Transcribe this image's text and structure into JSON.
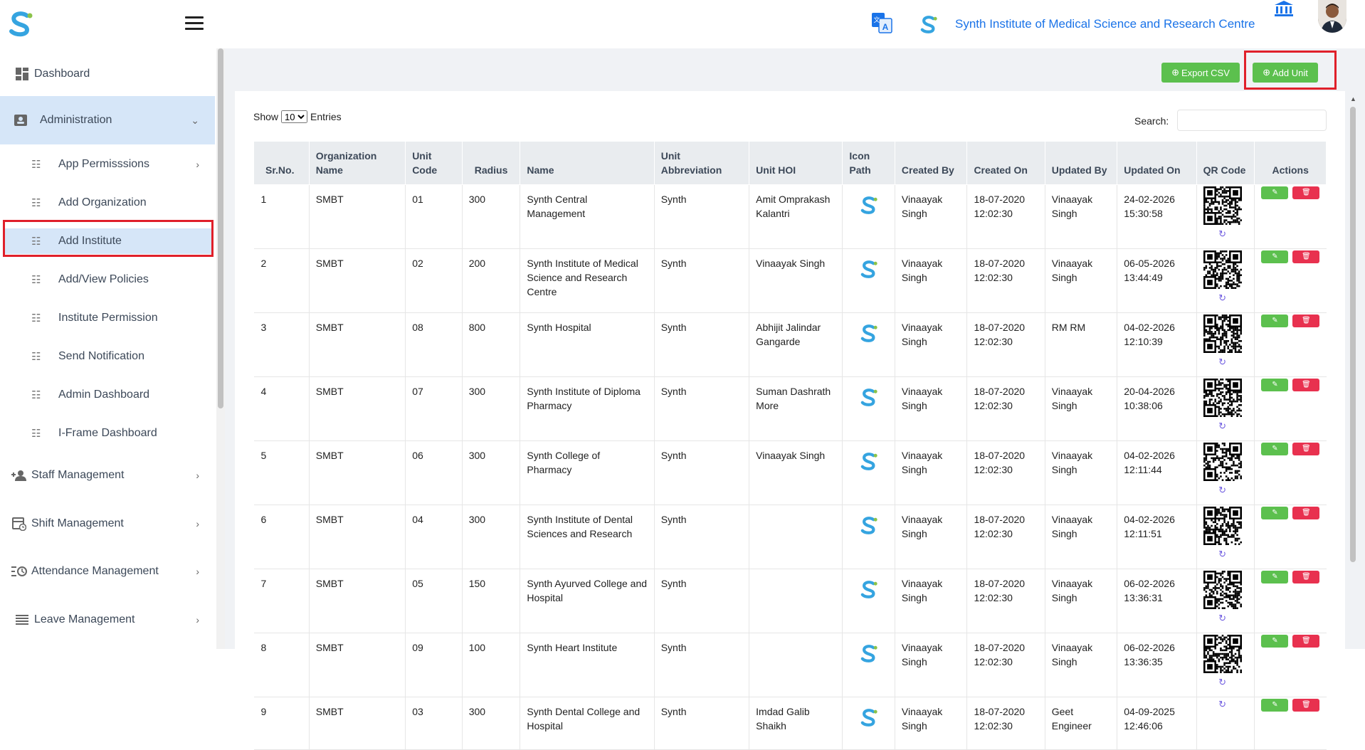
{
  "header": {
    "institute_name": "Synth Institute of Medical Science and Research Centre",
    "icons": [
      "logo-icon",
      "menu-icon",
      "translate-icon",
      "bank-icon"
    ]
  },
  "sidebar": {
    "dashboard": "Dashboard",
    "administration": "Administration",
    "sub_items": [
      {
        "label": "App Permisssions",
        "has_chevron": true
      },
      {
        "label": "Add Organization",
        "has_chevron": false
      },
      {
        "label": "Add Institute",
        "has_chevron": false
      },
      {
        "label": "Add/View Policies",
        "has_chevron": false
      },
      {
        "label": "Institute Permission",
        "has_chevron": false
      },
      {
        "label": "Send Notification",
        "has_chevron": false
      },
      {
        "label": "Admin Dashboard",
        "has_chevron": false
      },
      {
        "label": "I-Frame Dashboard",
        "has_chevron": false
      }
    ],
    "staff": "Staff Management",
    "shift": "Shift Management",
    "attendance": "Attendance Management",
    "leave": "Leave Management"
  },
  "toolbar": {
    "export_label": "Export CSV",
    "add_unit_label": "Add Unit"
  },
  "controls": {
    "show": "Show",
    "entries_value": "10",
    "entries": "Entries",
    "search": "Search:"
  },
  "table": {
    "headers": [
      "Sr.No.",
      "Organization Name",
      "Unit Code",
      "Radius",
      "Name",
      "Unit Abbreviation",
      "Unit HOI",
      "Icon Path",
      "Created By",
      "Created On",
      "Updated By",
      "Updated On",
      "QR Code",
      "Actions"
    ],
    "rows": [
      {
        "sr": "1",
        "org": "SMBT",
        "code": "01",
        "radius": "300",
        "name": "Synth Central Management",
        "abbr": "Synth",
        "hoi": "Amit Omprakash Kalantri",
        "created_by": "Vinaayak Singh",
        "created_on": "18-07-2020 12:02:30",
        "updated_by": "Vinaayak Singh",
        "updated_on": "24-02-2026 15:30:58",
        "qr": true
      },
      {
        "sr": "2",
        "org": "SMBT",
        "code": "02",
        "radius": "200",
        "name": "Synth Institute of Medical Science and Research Centre",
        "abbr": "Synth",
        "hoi": "Vinaayak Singh",
        "created_by": "Vinaayak Singh",
        "created_on": "18-07-2020 12:02:30",
        "updated_by": "Vinaayak Singh",
        "updated_on": "06-05-2026 13:44:49",
        "qr": true
      },
      {
        "sr": "3",
        "org": "SMBT",
        "code": "08",
        "radius": "800",
        "name": "Synth Hospital",
        "abbr": "Synth",
        "hoi": "Abhijit Jalindar Gangarde",
        "created_by": "Vinaayak Singh",
        "created_on": "18-07-2020 12:02:30",
        "updated_by": "RM RM",
        "updated_on": "04-02-2026 12:10:39",
        "qr": true
      },
      {
        "sr": "4",
        "org": "SMBT",
        "code": "07",
        "radius": "300",
        "name": "Synth Institute of Diploma Pharmacy",
        "abbr": "Synth",
        "hoi": "Suman Dashrath More",
        "created_by": "Vinaayak Singh",
        "created_on": "18-07-2020 12:02:30",
        "updated_by": "Vinaayak Singh",
        "updated_on": "20-04-2026 10:38:06",
        "qr": true
      },
      {
        "sr": "5",
        "org": "SMBT",
        "code": "06",
        "radius": "300",
        "name": "Synth College of Pharmacy",
        "abbr": "Synth",
        "hoi": "Vinaayak Singh",
        "created_by": "Vinaayak Singh",
        "created_on": "18-07-2020 12:02:30",
        "updated_by": "Vinaayak Singh",
        "updated_on": "04-02-2026 12:11:44",
        "qr": true
      },
      {
        "sr": "6",
        "org": "SMBT",
        "code": "04",
        "radius": "300",
        "name": "Synth Institute of Dental Sciences and Research",
        "abbr": "Synth",
        "hoi": "",
        "created_by": "Vinaayak Singh",
        "created_on": "18-07-2020 12:02:30",
        "updated_by": "Vinaayak Singh",
        "updated_on": "04-02-2026 12:11:51",
        "qr": true
      },
      {
        "sr": "7",
        "org": "SMBT",
        "code": "05",
        "radius": "150",
        "name": "Synth Ayurved College and Hospital",
        "abbr": "Synth",
        "hoi": "",
        "created_by": "Vinaayak Singh",
        "created_on": "18-07-2020 12:02:30",
        "updated_by": "Vinaayak Singh",
        "updated_on": "06-02-2026 13:36:31",
        "qr": true
      },
      {
        "sr": "8",
        "org": "SMBT",
        "code": "09",
        "radius": "100",
        "name": "Synth Heart Institute",
        "abbr": "Synth",
        "hoi": "",
        "created_by": "Vinaayak Singh",
        "created_on": "18-07-2020 12:02:30",
        "updated_by": "Vinaayak Singh",
        "updated_on": "06-02-2026 13:36:35",
        "qr": true
      },
      {
        "sr": "9",
        "org": "SMBT",
        "code": "03",
        "radius": "300",
        "name": "Synth Dental College and Hospital",
        "abbr": "Synth",
        "hoi": "Imdad Galib Shaikh",
        "created_by": "Vinaayak Singh",
        "created_on": "18-07-2020 12:02:30",
        "updated_by": "Geet Engineer",
        "updated_on": "04-09-2025 12:46:06",
        "qr": false
      }
    ]
  },
  "colors": {
    "accent": "#1a73e8",
    "success": "#5cc04e",
    "danger": "#e8314f",
    "highlight": "#e0202a",
    "active_bg": "#d6e6f8"
  }
}
